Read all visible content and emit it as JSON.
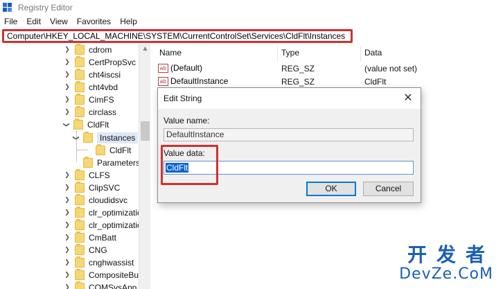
{
  "window": {
    "title": "Registry Editor"
  },
  "menu": [
    "File",
    "Edit",
    "View",
    "Favorites",
    "Help"
  ],
  "address": "Computer\\HKEY_LOCAL_MACHINE\\SYSTEM\\CurrentControlSet\\Services\\CldFlt\\Instances",
  "tree": {
    "items": [
      {
        "label": "cdrom",
        "state": "collapsed"
      },
      {
        "label": "CertPropSvc",
        "state": "collapsed"
      },
      {
        "label": "cht4iscsi",
        "state": "collapsed"
      },
      {
        "label": "cht4vbd",
        "state": "collapsed"
      },
      {
        "label": "CimFS",
        "state": "collapsed"
      },
      {
        "label": "circlass",
        "state": "collapsed"
      },
      {
        "label": "CldFlt",
        "state": "expanded"
      },
      {
        "label": "Instances",
        "state": "expanded",
        "selected": true
      },
      {
        "label": "CldFlt",
        "state": "leaf"
      },
      {
        "label": "Parameters",
        "state": "leaf"
      },
      {
        "label": "CLFS",
        "state": "collapsed"
      },
      {
        "label": "ClipSVC",
        "state": "collapsed"
      },
      {
        "label": "cloudidsvc",
        "state": "collapsed"
      },
      {
        "label": "clr_optimizatic",
        "state": "collapsed"
      },
      {
        "label": "clr_optimizatic",
        "state": "collapsed"
      },
      {
        "label": "CmBatt",
        "state": "collapsed"
      },
      {
        "label": "CNG",
        "state": "collapsed"
      },
      {
        "label": "cnghwassist",
        "state": "collapsed"
      },
      {
        "label": "CompositeBus",
        "state": "collapsed"
      },
      {
        "label": "COMSysApp",
        "state": "collapsed"
      }
    ]
  },
  "list": {
    "columns": [
      "Name",
      "Type",
      "Data"
    ],
    "rows": [
      {
        "name": "(Default)",
        "type": "REG_SZ",
        "data": "(value not set)",
        "icon": "ab-string-icon"
      },
      {
        "name": "DefaultInstance",
        "type": "REG_SZ",
        "data": "CldFlt",
        "icon": "ab-string-icon"
      }
    ]
  },
  "dialog": {
    "title": "Edit String",
    "value_name_label": "Value name:",
    "value_name": "DefaultInstance",
    "value_data_label": "Value data:",
    "value_data": "CldFlt",
    "ok_label": "OK",
    "cancel_label": "Cancel"
  },
  "watermark": {
    "top": "开发者",
    "bottom": "DevZe.CoM"
  },
  "colors": {
    "highlight": "#d32f2f",
    "selection": "#0a64d2",
    "watermark": "#1b5fb5"
  }
}
